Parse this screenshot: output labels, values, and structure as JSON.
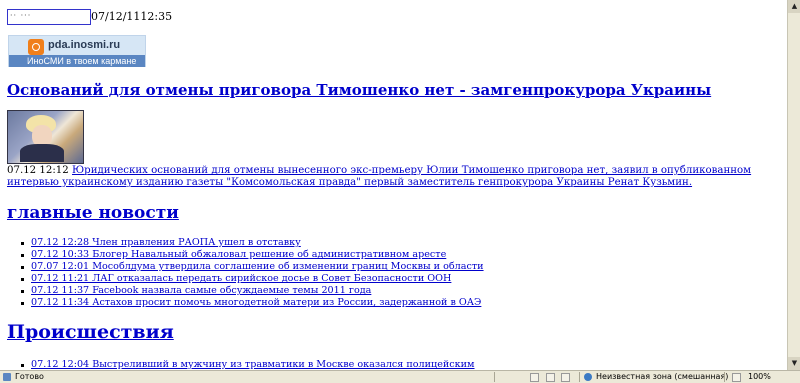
{
  "top": {
    "date_text": "07/12/1112:35"
  },
  "banner": {
    "domain": "pda.inosmi.ru",
    "slogan": "ИноСМИ в твоем кармане"
  },
  "article": {
    "headline": "Оснований для отмены приговора Тимошенко нет - замгенпрокурора Украины",
    "time": "07.12 12:12",
    "lead": "Юридических оснований для отмены вынесенного экс-премьеру Юлии Тимошенко приговора нет, заявил в опубликованном интервью украинскому изданию газеты \"Комсомольская правда\" первый заместитель генпрокурора Украины Ренат Кузьмин."
  },
  "sections": {
    "main_news": {
      "title": "главные новости",
      "items": [
        "07.12 12:28 Член правления РАОПА ушел в отставку",
        "07.12 10:33 Блогер Навальный обжаловал решение об административном аресте",
        "07.07 12:01 Мособлдума утвердила соглашение об изменении границ Москвы и области",
        "07.12 11:21 ЛАГ отказалась передать сирийское досье в Совет Безопасности ООН",
        "07.12 11:37 Facebook назвала самые обсуждаемые темы 2011 года",
        "07.12 11:34 Астахов просит помочь многодетной матери из России, задержанной в ОАЭ"
      ]
    },
    "incidents": {
      "title": "Происшествия",
      "items": [
        "07.12 12:04 Выстреливший в мужчину из травматики в Москве оказался полицейским"
      ]
    }
  },
  "statusbar": {
    "ready": "Готово",
    "zone": "Неизвестная зона (смешанная)",
    "zoom": "100%"
  }
}
